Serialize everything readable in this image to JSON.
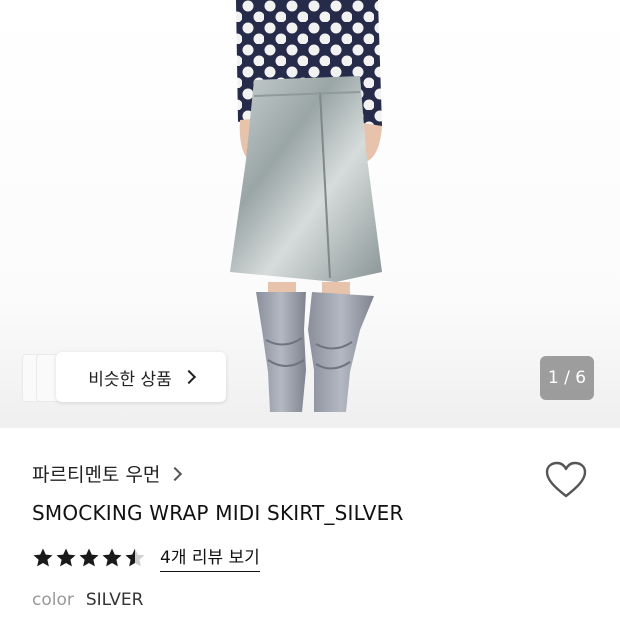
{
  "product_image": {
    "similar_button_label": "비슷한 상품",
    "image_counter": "1 / 6"
  },
  "product": {
    "brand": "파르티멘토 우먼",
    "title": "SMOCKING WRAP MIDI SKIRT_SILVER",
    "rating": 4.5,
    "review_link": "4개 리뷰 보기",
    "color_label": "color",
    "color_value": "SILVER"
  },
  "colors": {
    "star": "#1a1a1a",
    "star_empty": "#d0d0d0",
    "heart_stroke": "#555555"
  }
}
